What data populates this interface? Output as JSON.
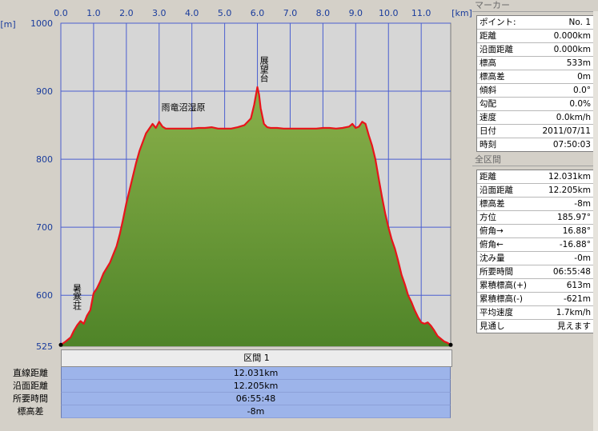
{
  "chart_data": {
    "type": "area",
    "x_unit_label": "[km]",
    "y_unit_label": "[m]",
    "xlim": [
      0,
      11.9
    ],
    "ylim": [
      525,
      1000
    ],
    "x_ticks": [
      "0.0",
      "1.0",
      "2.0",
      "3.0",
      "4.0",
      "5.0",
      "6.0",
      "7.0",
      "8.0",
      "9.0",
      "10.0",
      "11.0"
    ],
    "y_ticks": [
      "1000",
      "900",
      "800",
      "700",
      "600",
      "525"
    ],
    "grid": true,
    "fill_color": "#6e9a3a",
    "line_color": "#e8141a",
    "plot_bg": "#d6d6d6",
    "grid_color": "#4a5ed0",
    "x": [
      0.0,
      0.15,
      0.3,
      0.4,
      0.5,
      0.6,
      0.7,
      0.8,
      0.9,
      1.0,
      1.1,
      1.2,
      1.3,
      1.4,
      1.5,
      1.6,
      1.7,
      1.8,
      1.9,
      2.0,
      2.1,
      2.2,
      2.3,
      2.4,
      2.5,
      2.6,
      2.7,
      2.8,
      2.9,
      3.0,
      3.1,
      3.2,
      3.4,
      3.6,
      3.8,
      4.0,
      4.2,
      4.4,
      4.6,
      4.8,
      5.0,
      5.2,
      5.4,
      5.6,
      5.8,
      5.9,
      6.0,
      6.05,
      6.1,
      6.2,
      6.3,
      6.4,
      6.6,
      6.8,
      7.0,
      7.2,
      7.4,
      7.6,
      7.8,
      8.0,
      8.2,
      8.4,
      8.6,
      8.8,
      8.9,
      9.0,
      9.1,
      9.2,
      9.3,
      9.4,
      9.5,
      9.6,
      9.7,
      9.8,
      9.9,
      10.0,
      10.1,
      10.2,
      10.3,
      10.4,
      10.5,
      10.6,
      10.7,
      10.8,
      10.9,
      11.0,
      11.1,
      11.2,
      11.3,
      11.4,
      11.5,
      11.6,
      11.7,
      11.8,
      11.9
    ],
    "y": [
      527,
      532,
      538,
      548,
      556,
      562,
      558,
      570,
      578,
      603,
      610,
      620,
      632,
      640,
      648,
      660,
      672,
      690,
      712,
      735,
      755,
      775,
      795,
      812,
      825,
      838,
      845,
      852,
      846,
      855,
      848,
      845,
      845,
      845,
      845,
      845,
      846,
      846,
      847,
      845,
      845,
      845,
      847,
      850,
      860,
      880,
      906,
      895,
      875,
      852,
      847,
      846,
      846,
      845,
      845,
      845,
      845,
      845,
      845,
      846,
      846,
      845,
      846,
      848,
      852,
      846,
      848,
      855,
      852,
      835,
      820,
      800,
      772,
      745,
      720,
      700,
      682,
      668,
      650,
      630,
      616,
      600,
      590,
      578,
      568,
      560,
      558,
      560,
      555,
      548,
      540,
      536,
      532,
      530,
      527
    ],
    "annotations": [
      {
        "text": "展望台",
        "x": 6.05,
        "y": 906
      },
      {
        "text": "雨竜沼湿原",
        "x": 3.3,
        "y": 850
      },
      {
        "text": "暑寒荘",
        "x": 0.2,
        "y": 560
      }
    ]
  },
  "section_table": {
    "header": "区間 1",
    "rows": [
      {
        "label": "直線距離",
        "value": "12.031km"
      },
      {
        "label": "沿面距離",
        "value": "12.205km"
      },
      {
        "label": "所要時間",
        "value": "06:55:48"
      },
      {
        "label": "標高差",
        "value": "-8m"
      }
    ]
  },
  "marker_panel": {
    "title": "マーカー",
    "rows": [
      {
        "k": "ポイント:",
        "v": "No. 1"
      },
      {
        "k": "距離",
        "v": "0.000km"
      },
      {
        "k": "沿面距離",
        "v": "0.000km"
      },
      {
        "k": "標高",
        "v": "533m"
      },
      {
        "k": "標高差",
        "v": "0m"
      },
      {
        "k": "傾斜",
        "v": "0.0°"
      },
      {
        "k": "勾配",
        "v": "0.0%"
      },
      {
        "k": "速度",
        "v": "0.0km/h"
      },
      {
        "k": "日付",
        "v": "2011/07/11"
      },
      {
        "k": "時刻",
        "v": "07:50:03"
      }
    ]
  },
  "total_panel": {
    "title": "全区間",
    "rows": [
      {
        "k": "距離",
        "v": "12.031km"
      },
      {
        "k": "沿面距離",
        "v": "12.205km"
      },
      {
        "k": "標高差",
        "v": "-8m"
      },
      {
        "k": "方位",
        "v": "185.97°"
      },
      {
        "k": "俯角→",
        "v": "16.88°"
      },
      {
        "k": "俯角←",
        "v": "-16.88°"
      },
      {
        "k": "沈み量",
        "v": "-0m"
      },
      {
        "k": "所要時間",
        "v": "06:55:48"
      },
      {
        "k": "累積標高(+)",
        "v": "613m"
      },
      {
        "k": "累積標高(-)",
        "v": "-621m"
      },
      {
        "k": "平均速度",
        "v": "1.7km/h"
      },
      {
        "k": "見通し",
        "v": "見えます"
      }
    ]
  }
}
